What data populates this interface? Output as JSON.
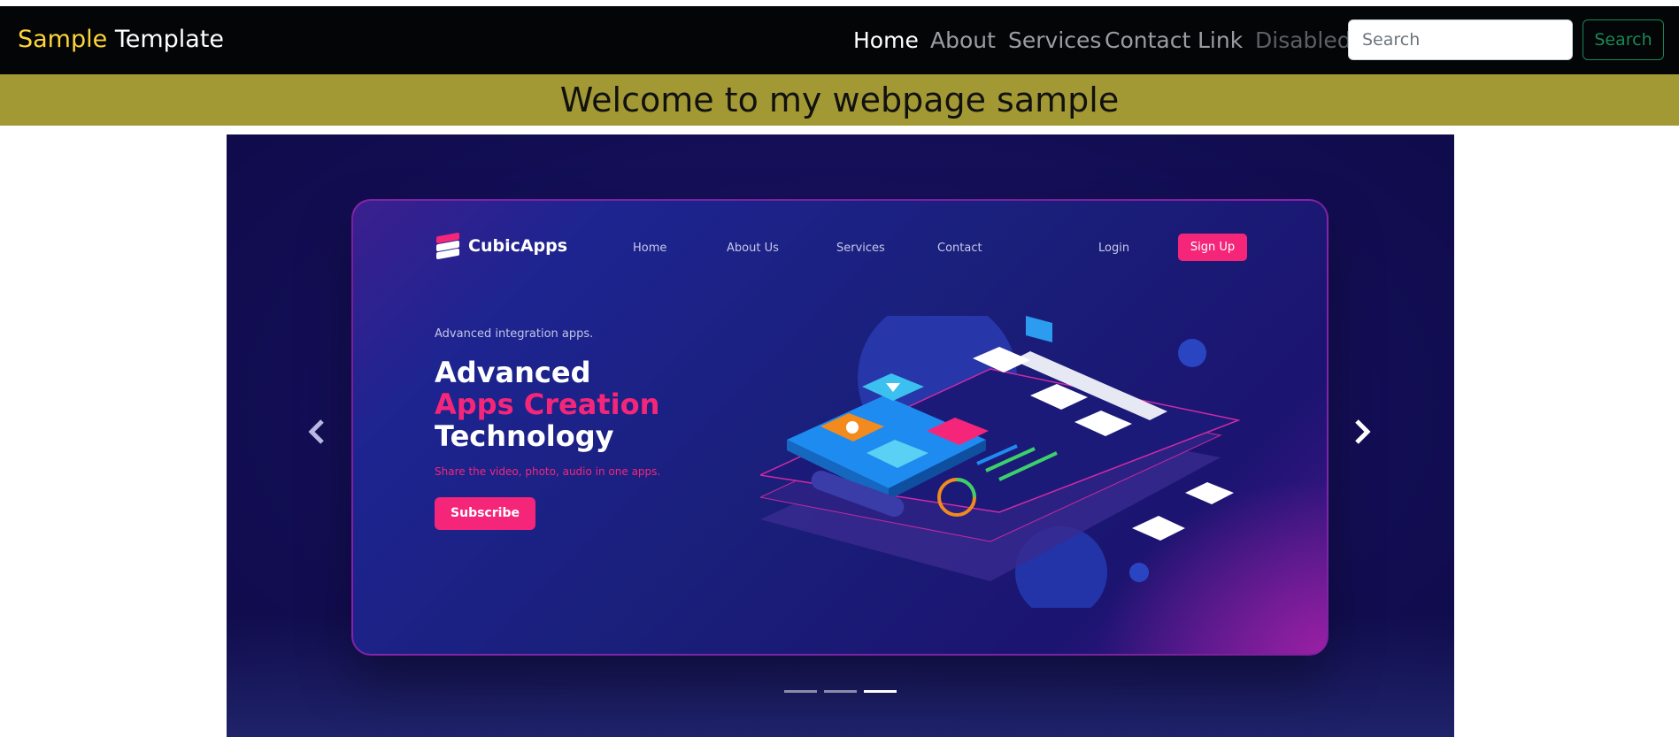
{
  "navbar": {
    "brand_part1": "Sample",
    "brand_part2": "Template",
    "brand_color": "#ffd43b",
    "items": [
      {
        "label": "Home",
        "state": "active"
      },
      {
        "label": "About",
        "state": "normal"
      },
      {
        "label": "Services",
        "state": "normal"
      },
      {
        "label": "Contact",
        "state": "normal"
      },
      {
        "label": "Link",
        "state": "normal"
      },
      {
        "label": "Disabled",
        "state": "disabled"
      }
    ],
    "search_placeholder": "Search",
    "search_button": "Search",
    "search_button_color": "#198754"
  },
  "banner": {
    "title": "Welcome to my webpage sample",
    "background": "#a39934"
  },
  "carousel": {
    "slide_count": 3,
    "active_index": 2,
    "prev_icon": "chevron-left-icon",
    "next_icon": "chevron-right-icon",
    "slide": {
      "logo_text": "CubicApps",
      "nav": [
        "Home",
        "About Us",
        "Services",
        "Contact"
      ],
      "login": "Login",
      "signup": "Sign Up",
      "kicker": "Advanced integration apps.",
      "headline_1": "Advanced",
      "headline_2": "Apps Creation",
      "headline_3": "Technology",
      "subtitle": "Share the video, photo, audio in one apps.",
      "cta": "Subscribe",
      "accent": "#f5267a"
    }
  }
}
